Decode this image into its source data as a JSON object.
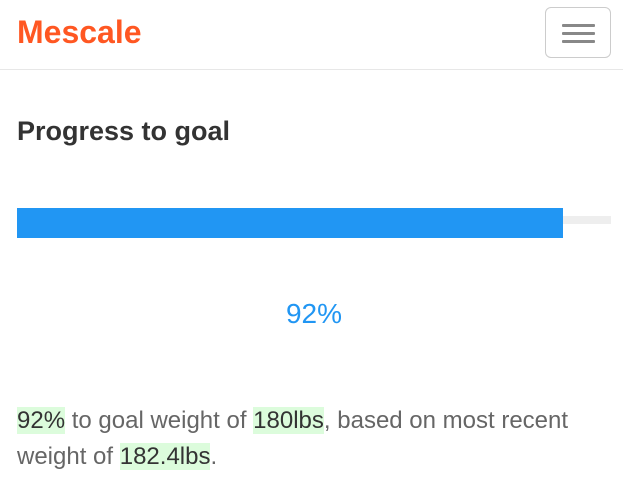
{
  "navbar": {
    "brand": "Mescale",
    "menu_icon": "hamburger-menu-icon"
  },
  "main": {
    "heading": "Progress to goal",
    "progress": {
      "fraction": 0.92,
      "label": "92%"
    },
    "summary": {
      "percent": "92%",
      "text1": " to goal weight of ",
      "goal_weight": "180lbs",
      "text2": ", based on most recent weight of ",
      "recent_weight": "182.4lbs",
      "text3": "."
    }
  },
  "colors": {
    "brand": "#ff5722",
    "progress": "#2196f3",
    "highlight": "#dcfcdc"
  }
}
